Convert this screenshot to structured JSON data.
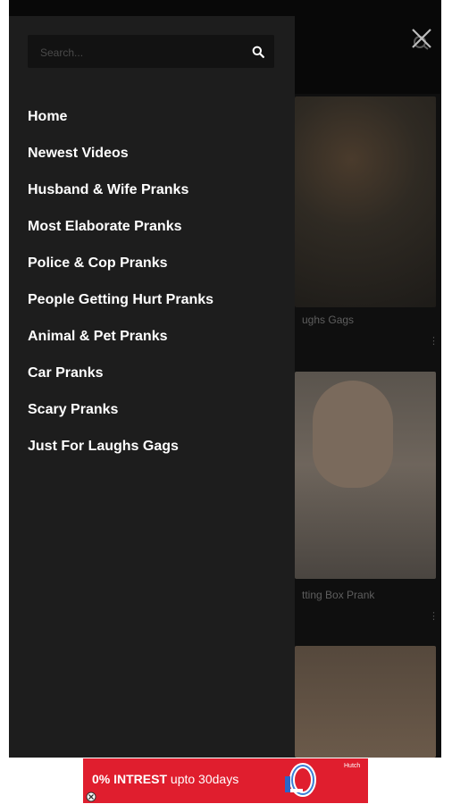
{
  "search": {
    "placeholder": "Search..."
  },
  "drawer": {
    "items": [
      {
        "label": "Home"
      },
      {
        "label": "Newest Videos"
      },
      {
        "label": "Husband & Wife Pranks"
      },
      {
        "label": "Most Elaborate Pranks"
      },
      {
        "label": "Police & Cop Pranks"
      },
      {
        "label": "People Getting Hurt Pranks"
      },
      {
        "label": "Animal & Pet Pranks"
      },
      {
        "label": "Car Pranks"
      },
      {
        "label": "Scary Pranks"
      },
      {
        "label": "Just For Laughs Gags"
      }
    ]
  },
  "background": {
    "captions": [
      "ughs Gags",
      "tting Box Prank"
    ]
  },
  "ad": {
    "headline": "0% INTREST",
    "subline": "upto 30days",
    "brand": "Hutch"
  },
  "colors": {
    "drawer_bg": "#1d1d1d",
    "search_bg": "#121212",
    "menu_text": "#ffffff",
    "ad_red": "#e01e2e"
  },
  "icons": {
    "search": "search-icon",
    "close": "close-icon",
    "more": "more-vertical-icon",
    "ad_info": "ad-info-icon"
  }
}
